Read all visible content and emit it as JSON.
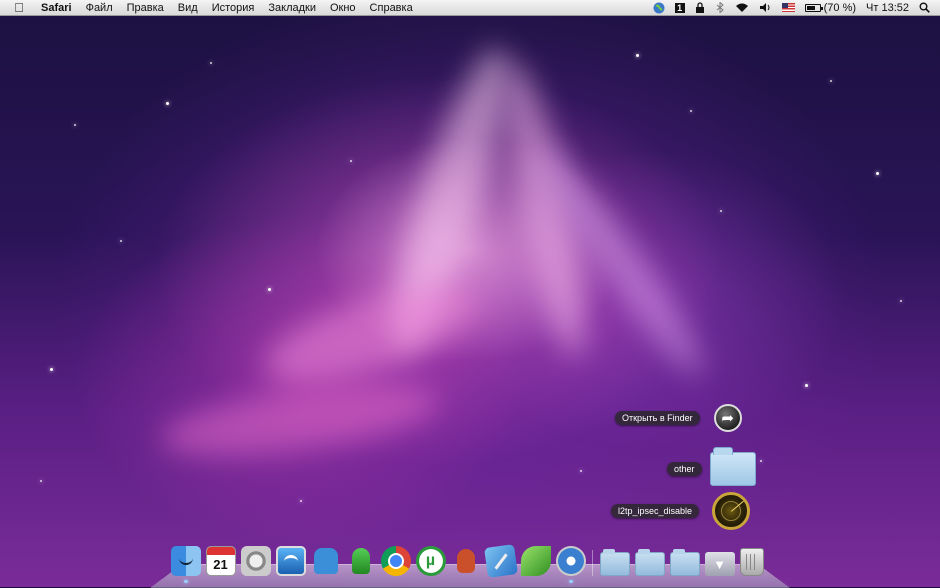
{
  "menubar": {
    "apple_icon": "apple-logo-icon",
    "app_name": "Safari",
    "menus": [
      "Файл",
      "Правка",
      "Вид",
      "История",
      "Закладки",
      "Окно",
      "Справка"
    ],
    "status": {
      "globe_icon": "globe-icon",
      "box_label": "1",
      "lock_icon": "lock-icon",
      "bluetooth_icon": "bluetooth-icon",
      "wifi_icon": "wifi-icon",
      "volume_icon": "volume-icon",
      "flag_icon": "us-flag-icon",
      "battery_text": "(70 %)",
      "battery_level": 0.7,
      "clock": "Чт 13:52",
      "spotlight_icon": "spotlight-icon"
    }
  },
  "stack": {
    "open_in_finder": "Открыть в Finder",
    "items": [
      {
        "label": "other",
        "icon": "folder-icon"
      },
      {
        "label": "l2tp_ipsec_disable",
        "icon": "radar-icon"
      }
    ]
  },
  "dock": {
    "apps": [
      {
        "name": "finder",
        "icon": "finder-icon",
        "running": true
      },
      {
        "name": "calendar",
        "icon": "calendar-icon",
        "text": "21"
      },
      {
        "name": "system-preferences",
        "icon": "gear-icon"
      },
      {
        "name": "dashboard",
        "icon": "dashboard-icon"
      },
      {
        "name": "adium",
        "icon": "adium-icon"
      },
      {
        "name": "ichat",
        "icon": "chat-icon"
      },
      {
        "name": "chrome",
        "icon": "chrome-icon"
      },
      {
        "name": "utorrent",
        "icon": "utorrent-icon",
        "text": "µ"
      },
      {
        "name": "cyberduck",
        "icon": "duck-icon"
      },
      {
        "name": "xcode",
        "icon": "xcode-icon"
      },
      {
        "name": "leaf",
        "icon": "leaf-icon"
      },
      {
        "name": "safari",
        "icon": "safari-icon",
        "running": true
      }
    ],
    "stacks": [
      {
        "name": "applications-stack",
        "icon": "applications-folder-icon"
      },
      {
        "name": "documents-stack",
        "icon": "documents-folder-icon"
      },
      {
        "name": "other-stack",
        "icon": "folder-icon"
      },
      {
        "name": "downloads-stack",
        "icon": "downloads-icon"
      },
      {
        "name": "trash",
        "icon": "trash-icon"
      }
    ]
  }
}
